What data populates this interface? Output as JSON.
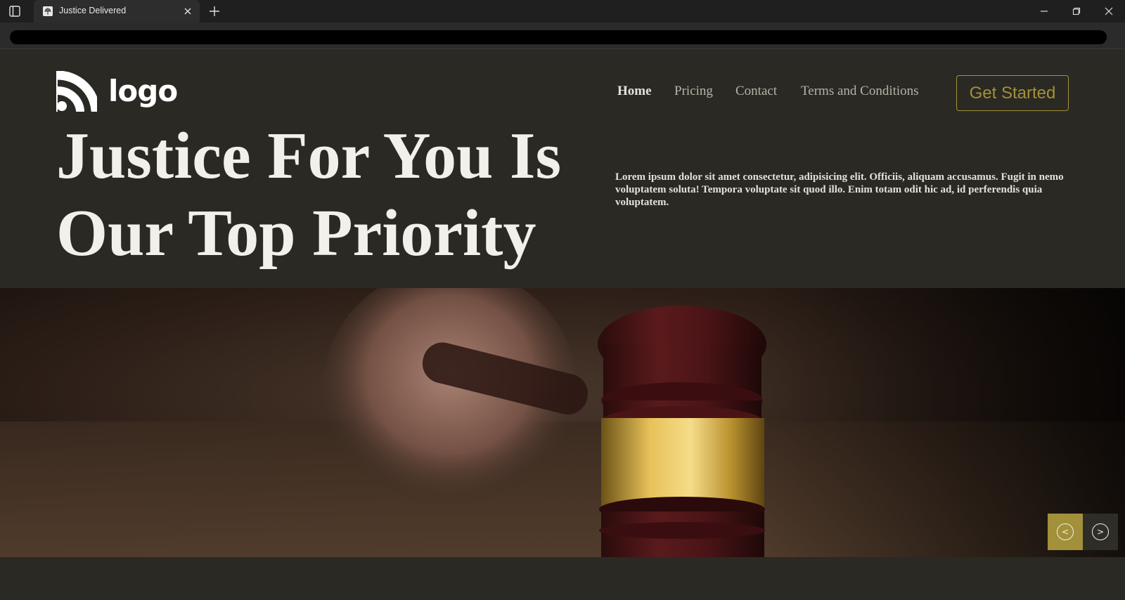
{
  "browser": {
    "tab_title": "Justice Delivered"
  },
  "header": {
    "logo_text": "logo",
    "nav": [
      "Home",
      "Pricing",
      "Contact",
      "Terms and Conditions"
    ],
    "cta_label": "Get Started"
  },
  "hero": {
    "title": "Justice For You Is Our Top Priority",
    "description": "Lorem ipsum dolor sit amet consectetur, adipisicing elit. Officiis, aliquam accusamus. Fugit in nemo voluptatem soluta! Tempora voluptate sit quod illo. Enim totam odit hic ad, id perferendis quia voluptatem."
  },
  "carousel": {
    "prev_label": "<",
    "next_label": ">"
  },
  "colors": {
    "background": "#2b2923",
    "accent_gold": "#a3903a",
    "text_light": "#f2f0eb"
  }
}
